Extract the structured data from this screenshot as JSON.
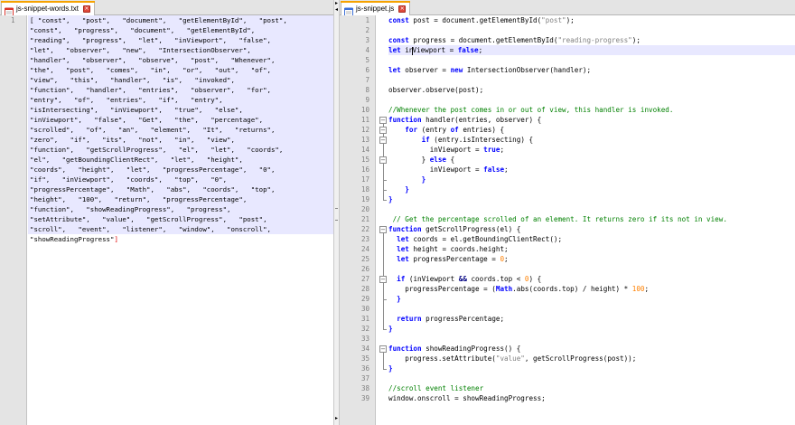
{
  "left_tab": {
    "label": "js-snippet-words.txt",
    "close": "×"
  },
  "right_tab": {
    "label": "js-snippet.js",
    "close": "×"
  },
  "left_editor": {
    "line_numbers": [
      "1"
    ],
    "wrapped_lines": [
      "[ \"const\",   \"post\",   \"document\",   \"getElementById\",   \"post\",",
      "\"const\",   \"progress\",   \"document\",   \"getElementById\",",
      "\"reading\",   \"progress\",   \"let\",   \"inViewport\",   \"false\",",
      "\"let\",   \"observer\",   \"new\",   \"IntersectionObserver\",",
      "\"handler\",   \"observer\",   \"observe\",   \"post\",   \"Whenever\",",
      "\"the\",   \"post\",   \"comes\",   \"in\",   \"or\",   \"out\",   \"of\",",
      "\"view\",   \"this\",   \"handler\",   \"is\",   \"invoked\",",
      "\"function\",   \"handler\",   \"entries\",   \"observer\",   \"for\",",
      "\"entry\",   \"of\",   \"entries\",   \"if\",   \"entry\",",
      "\"isIntersecting\",   \"inViewport\",   \"true\",   \"else\",",
      "\"inViewport\",   \"false\",   \"Get\",   \"the\",   \"percentage\",",
      "\"scrolled\",   \"of\",   \"an\",   \"element\",   \"It\",   \"returns\",",
      "\"zero\",   \"if\",   \"its\",   \"not\",   \"in\",   \"view\",",
      "\"function\",   \"getScrollProgress\",   \"el\",   \"let\",   \"coords\",",
      "\"el\",   \"getBoundingClientRect\",   \"let\",   \"height\",",
      "\"coords\",   \"height\",   \"let\",   \"progressPercentage\",   \"0\",",
      "\"if\",   \"inViewport\",   \"coords\",   \"top\",   \"0\",",
      "\"progressPercentage\",   \"Math\",   \"abs\",   \"coords\",   \"top\",",
      "\"height\",   \"100\",   \"return\",   \"progressPercentage\",",
      "\"function\",   \"showReadingProgress\",   \"progress\",",
      "\"setAttribute\",   \"value\",   \"getScrollProgress\",   \"post\",",
      "\"scroll\",   \"event\",   \"listener\",   \"window\",   \"onscroll\","
    ],
    "last_line": "\"showReadingProgress\"",
    "last_bracket": "]"
  },
  "right_editor": {
    "line_numbers": [
      "1",
      "2",
      "3",
      "4",
      "5",
      "6",
      "7",
      "8",
      "9",
      "10",
      "11",
      "12",
      "13",
      "14",
      "15",
      "16",
      "17",
      "18",
      "19",
      "20",
      "21",
      "22",
      "23",
      "24",
      "25",
      "26",
      "27",
      "28",
      "29",
      "30",
      "31",
      "32",
      "33",
      "34",
      "35",
      "36",
      "37",
      "38",
      "39"
    ],
    "code": {
      "l1": {
        "a": "const",
        "b": " post = document.getElementById(",
        "c": "\"post\"",
        "d": ");"
      },
      "l3": {
        "a": "const",
        "b": " progress = document.getElementById(",
        "c": "\"reading-progress\"",
        "d": ");"
      },
      "l4": {
        "a": "let",
        "b": " in",
        "c": "Viewport = ",
        "d": "false",
        "e": ";"
      },
      "l6": {
        "a": "let",
        "b": " observer = ",
        "c": "new",
        "d": " IntersectionObserver(handler);"
      },
      "l8": {
        "a": "observer.observe(post);"
      },
      "l10": {
        "a": "//Whenever the post comes in or out of view, this handler is invoked."
      },
      "l11": {
        "a": "function",
        "b": " handler(entries, observer) {"
      },
      "l12": {
        "a": "    ",
        "b": "for",
        "c": " (entry ",
        "d": "of",
        "e": " entries) {"
      },
      "l13": {
        "a": "        ",
        "b": "if",
        "c": " (entry.isIntersecting) {"
      },
      "l14": {
        "a": "          inViewport = ",
        "b": "true",
        "c": ";"
      },
      "l15": {
        "a": "        } ",
        "b": "else",
        "c": " {"
      },
      "l16": {
        "a": "          inViewport = ",
        "b": "false",
        "c": ";"
      },
      "l17": {
        "a": "        }"
      },
      "l18": {
        "a": "    }"
      },
      "l19": {
        "a": "}"
      },
      "l21": {
        "a": " // Get the percentage scrolled of an element. It returns zero if its not in view."
      },
      "l22": {
        "a": "function",
        "b": " getScrollProgress(el) {"
      },
      "l23": {
        "a": "  ",
        "b": "let",
        "c": " coords = el.getBoundingClientRect();"
      },
      "l24": {
        "a": "  ",
        "b": "let",
        "c": " height = coords.height;"
      },
      "l25": {
        "a": "  ",
        "b": "let",
        "c": " progressPercentage = ",
        "d": "0",
        "e": ";"
      },
      "l27": {
        "a": "  ",
        "b": "if",
        "c": " (inViewport ",
        "d": "&&",
        "e": " coords.top < ",
        "f": "0",
        "g": ") {"
      },
      "l28": {
        "a": "    progressPercentage = (",
        "b": "Math",
        "c": ".abs(coords.top) / height) * ",
        "d": "100",
        "e": ";"
      },
      "l29": {
        "a": "  }"
      },
      "l31": {
        "a": "  ",
        "b": "return",
        "c": " progressPercentage;"
      },
      "l32": {
        "a": "}"
      },
      "l34": {
        "a": "function",
        "b": " showReadingProgress() {"
      },
      "l35": {
        "a": "    progress.setAttribute(",
        "b": "\"value\"",
        "c": ", getScrollProgress(post));"
      },
      "l36": {
        "a": "}"
      },
      "l38": {
        "a": "//scroll event listener"
      },
      "l39": {
        "a": "window.onscroll = showReadingProgress;"
      }
    }
  },
  "colors": {
    "tab_accent": "#f6a200",
    "keyword": "#0000ff",
    "string": "#808080",
    "number": "#ff8000",
    "comment": "#008000",
    "selection": "#e8e8ff",
    "gutter": "#e4e4e4"
  },
  "icons": {
    "left_tab_icon": "notepad-file-icon",
    "right_tab_icon": "notepad-file-icon",
    "close": "close-icon",
    "fold_open": "fold-minus-icon"
  }
}
